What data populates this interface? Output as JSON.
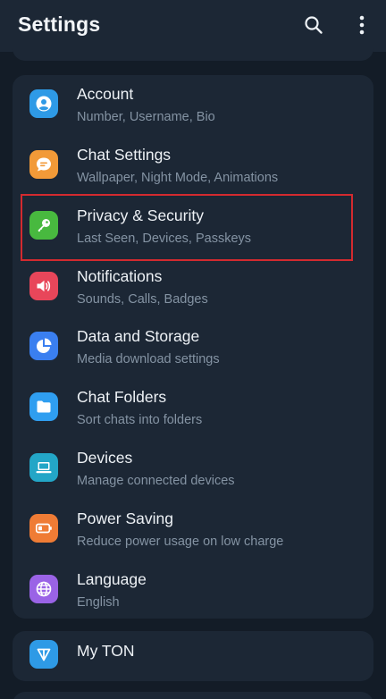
{
  "header": {
    "title": "Settings",
    "search_icon": "search-icon",
    "more_icon": "more-vertical-icon"
  },
  "main_menu": {
    "items": [
      {
        "title": "Account",
        "subtitle": "Number, Username, Bio",
        "icon": "person-icon",
        "color": "#2e9ae6"
      },
      {
        "title": "Chat Settings",
        "subtitle": "Wallpaper, Night Mode, Animations",
        "icon": "chat-bubble-icon",
        "color": "#f29a38"
      },
      {
        "title": "Privacy & Security",
        "subtitle": "Last Seen, Devices, Passkeys",
        "icon": "key-icon",
        "color": "#48b93f"
      },
      {
        "title": "Notifications",
        "subtitle": "Sounds, Calls, Badges",
        "icon": "speaker-icon",
        "color": "#e8465a"
      },
      {
        "title": "Data and Storage",
        "subtitle": "Media download settings",
        "icon": "pie-chart-icon",
        "color": "#3a7ff0"
      },
      {
        "title": "Chat Folders",
        "subtitle": "Sort chats into folders",
        "icon": "folder-icon",
        "color": "#2f9ef0"
      },
      {
        "title": "Devices",
        "subtitle": "Manage connected devices",
        "icon": "laptop-icon",
        "color": "#23a6c7"
      },
      {
        "title": "Power Saving",
        "subtitle": "Reduce power usage on low charge",
        "icon": "battery-icon",
        "color": "#ef7c35"
      },
      {
        "title": "Language",
        "subtitle": "English",
        "icon": "globe-icon",
        "color": "#9a63e6"
      }
    ]
  },
  "ton": {
    "title": "My TON",
    "icon": "ton-icon",
    "color": "#2e9ae6"
  },
  "colors": {
    "background": "#131c27",
    "card": "#1c2735",
    "highlight": "#d32a2f"
  }
}
